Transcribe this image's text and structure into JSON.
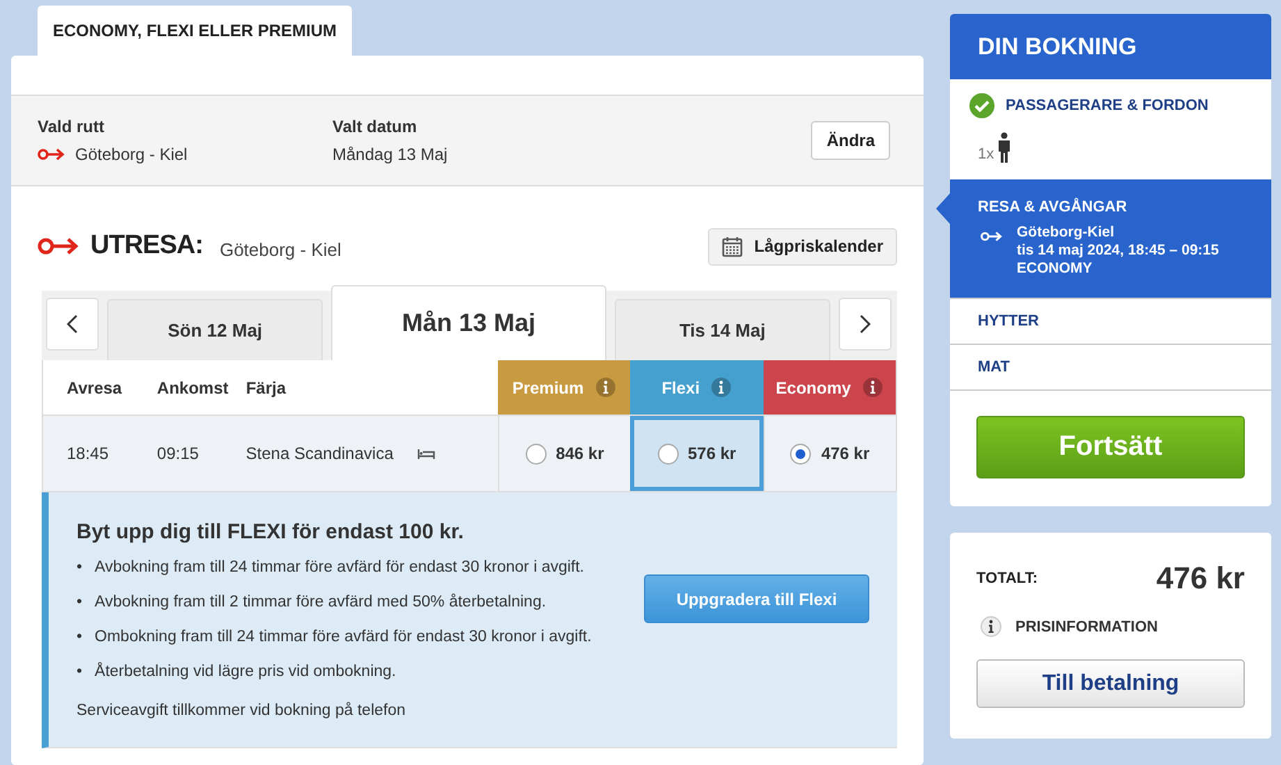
{
  "tab": {
    "label": "ECONOMY, FLEXI ELLER PREMIUM",
    "selected": true
  },
  "summary": {
    "route_label": "Vald rutt",
    "route": "Göteborg - Kiel",
    "date_label": "Valt datum",
    "date": "Måndag 13 Maj",
    "change_button": "Ändra"
  },
  "outbound": {
    "title": "UTRESA:",
    "route": "Göteborg - Kiel",
    "calendar_button": "Lågpriskalender"
  },
  "days": [
    {
      "label": "Sön 12 Maj",
      "selected": false
    },
    {
      "label": "Mån 13 Maj",
      "selected": true
    },
    {
      "label": "Tis 14 Maj",
      "selected": false
    }
  ],
  "table": {
    "columns": [
      "Avresa",
      "Ankomst",
      "Färja"
    ],
    "fares": [
      {
        "name": "Premium",
        "color": "#c99b40"
      },
      {
        "name": "Flexi",
        "color": "#46a0cf"
      },
      {
        "name": "Economy",
        "color": "#cc454c"
      }
    ],
    "rows": [
      {
        "departure": "18:45",
        "arrival": "09:15",
        "ferry": "Stena Scandinavica",
        "prices": [
          {
            "price": "846 kr",
            "selected": false,
            "highlighted": false
          },
          {
            "price": "576 kr",
            "selected": false,
            "highlighted": true
          },
          {
            "price": "476 kr",
            "selected": true,
            "highlighted": false
          }
        ]
      }
    ]
  },
  "upgrade": {
    "bullet": "•",
    "title": "Byt upp dig till FLEXI för endast 100 kr.",
    "points": [
      "Avbokning fram till 24 timmar före avfärd för endast 30 kronor i avgift.",
      "Avbokning fram till 2 timmar före avfärd med 50% återbetalning.",
      "Ombokning fram till 24 timmar före avfärd för endast 30 kronor i avgift.",
      "Återbetalning vid lägre pris vid ombokning."
    ],
    "note": "Serviceavgift tillkommer vid bokning på telefon",
    "button": "Uppgradera till Flexi"
  },
  "booking": {
    "title": "DIN BOKNING",
    "steps": [
      {
        "kind": "done",
        "title": "PASSAGERARE & FORDON",
        "count": "1x"
      },
      {
        "kind": "active",
        "title": "RESA & AVGÅNGAR",
        "lines": [
          "Göteborg-Kiel",
          "tis 14 maj 2024, 18:45 – 09:15",
          "ECONOMY"
        ]
      },
      {
        "kind": "plain",
        "title": "HYTTER"
      },
      {
        "kind": "plain",
        "title": "MAT"
      }
    ],
    "continue_button": "Fortsätt"
  },
  "total": {
    "label": "TOTALT:",
    "amount": "476 kr",
    "info": "PRISINFORMATION",
    "pay_button": "Till betalning"
  }
}
